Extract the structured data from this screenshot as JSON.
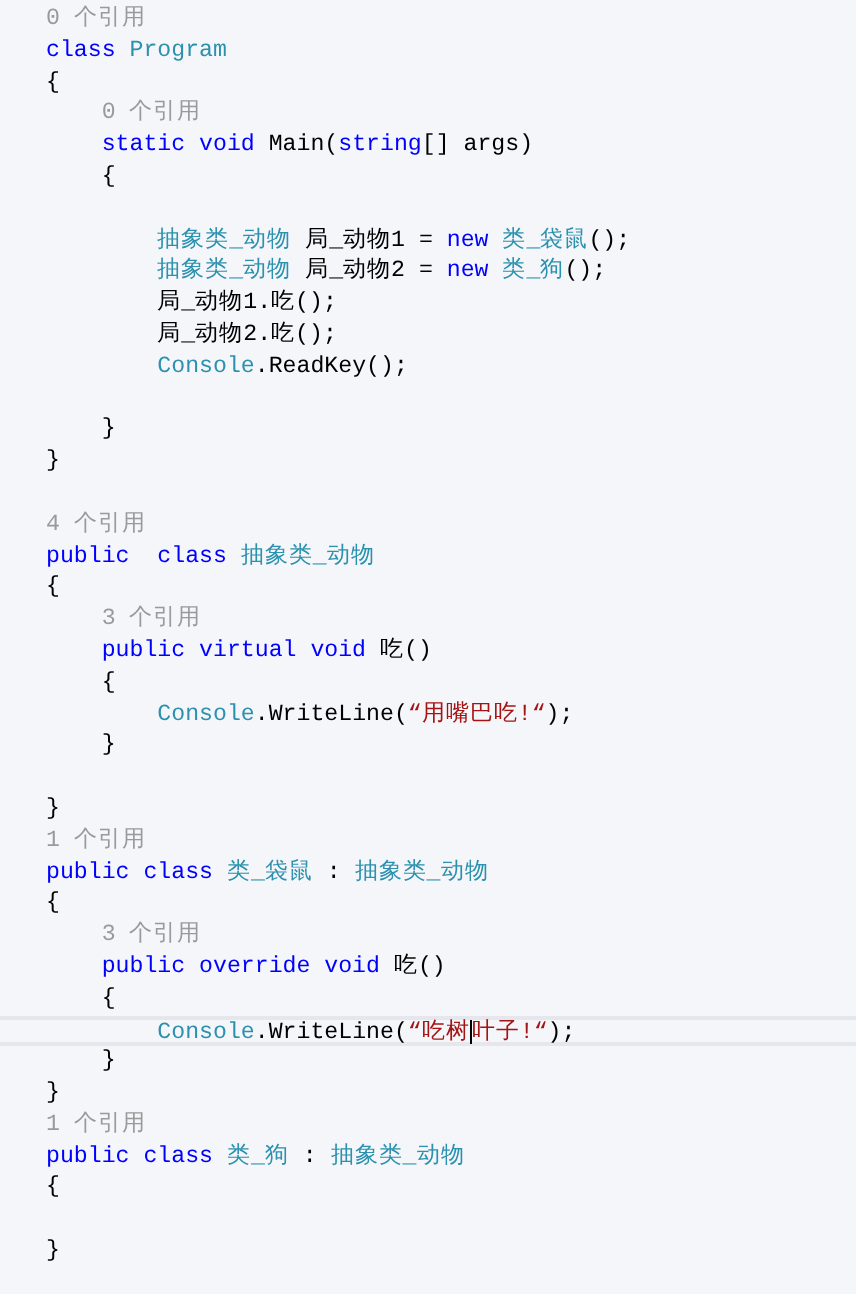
{
  "editor": {
    "lines": [
      {
        "tokens": [
          {
            "text": "0 个引用",
            "kind": "lens"
          }
        ]
      },
      {
        "tokens": [
          {
            "text": "class ",
            "kind": "keyword"
          },
          {
            "text": "Program",
            "kind": "type"
          }
        ]
      },
      {
        "tokens": [
          {
            "text": "{",
            "kind": "plain"
          }
        ]
      },
      {
        "tokens": [
          {
            "text": "    0 个引用",
            "kind": "lens"
          }
        ]
      },
      {
        "tokens": [
          {
            "text": "    static void ",
            "kind": "keyword"
          },
          {
            "text": "Main(",
            "kind": "plain"
          },
          {
            "text": "string",
            "kind": "keyword"
          },
          {
            "text": "[] args)",
            "kind": "plain"
          }
        ]
      },
      {
        "tokens": [
          {
            "text": "    {",
            "kind": "plain"
          }
        ]
      },
      {
        "space_before": true,
        "tokens": [
          {
            "text": "        抽象类_动物",
            "kind": "type"
          },
          {
            "text": " 局_动物1 = ",
            "kind": "plain"
          },
          {
            "text": "new ",
            "kind": "keyword"
          },
          {
            "text": "类_袋鼠",
            "kind": "type"
          },
          {
            "text": "();",
            "kind": "plain"
          }
        ]
      },
      {
        "tokens": [
          {
            "text": "        抽象类_动物",
            "kind": "type"
          },
          {
            "text": " 局_动物2 = ",
            "kind": "plain"
          },
          {
            "text": "new ",
            "kind": "keyword"
          },
          {
            "text": "类_狗",
            "kind": "type"
          },
          {
            "text": "();",
            "kind": "plain"
          }
        ]
      },
      {
        "tokens": [
          {
            "text": "        局_动物1.吃();",
            "kind": "plain"
          }
        ]
      },
      {
        "tokens": [
          {
            "text": "        局_动物2.吃();",
            "kind": "plain"
          }
        ]
      },
      {
        "tokens": [
          {
            "text": "        Console",
            "kind": "type"
          },
          {
            "text": ".ReadKey();",
            "kind": "plain"
          }
        ]
      },
      {
        "space_before": true,
        "tokens": [
          {
            "text": "    }",
            "kind": "plain"
          }
        ]
      },
      {
        "tokens": [
          {
            "text": "}",
            "kind": "plain"
          }
        ]
      },
      {
        "space_before": true,
        "tokens": [
          {
            "text": "4 个引用",
            "kind": "lens"
          }
        ]
      },
      {
        "tokens": [
          {
            "text": "public  class ",
            "kind": "keyword"
          },
          {
            "text": "抽象类_动物",
            "kind": "type"
          }
        ]
      },
      {
        "tokens": [
          {
            "text": "{",
            "kind": "plain"
          }
        ]
      },
      {
        "tokens": [
          {
            "text": "    3 个引用",
            "kind": "lens"
          }
        ]
      },
      {
        "tokens": [
          {
            "text": "    public virtual void ",
            "kind": "keyword"
          },
          {
            "text": "吃()",
            "kind": "plain"
          }
        ]
      },
      {
        "tokens": [
          {
            "text": "    {",
            "kind": "plain"
          }
        ]
      },
      {
        "tokens": [
          {
            "text": "        Console",
            "kind": "type"
          },
          {
            "text": ".WriteLine(",
            "kind": "plain"
          },
          {
            "text": "“用嘴巴吃!“",
            "kind": "string"
          },
          {
            "text": ");",
            "kind": "plain"
          }
        ]
      },
      {
        "tokens": [
          {
            "text": "    }",
            "kind": "plain"
          }
        ]
      },
      {
        "space_before": true,
        "tokens": [
          {
            "text": "}",
            "kind": "plain"
          }
        ]
      },
      {
        "tokens": [
          {
            "text": "1 个引用",
            "kind": "lens"
          }
        ]
      },
      {
        "tokens": [
          {
            "text": "public class ",
            "kind": "keyword"
          },
          {
            "text": "类_袋鼠",
            "kind": "type"
          },
          {
            "text": " : ",
            "kind": "plain"
          },
          {
            "text": "抽象类_动物",
            "kind": "type"
          }
        ]
      },
      {
        "tokens": [
          {
            "text": "{",
            "kind": "plain"
          }
        ]
      },
      {
        "tokens": [
          {
            "text": "    3 个引用",
            "kind": "lens"
          }
        ]
      },
      {
        "tokens": [
          {
            "text": "    public override void ",
            "kind": "keyword"
          },
          {
            "text": "吃()",
            "kind": "plain"
          }
        ]
      },
      {
        "tokens": [
          {
            "text": "    {",
            "kind": "plain"
          }
        ]
      },
      {
        "current": true,
        "tokens": [
          {
            "text": "        Console",
            "kind": "type"
          },
          {
            "text": ".WriteLine(",
            "kind": "plain"
          },
          {
            "text": "“吃树",
            "kind": "string",
            "caret_after": true
          },
          {
            "text": "叶子!“",
            "kind": "string"
          },
          {
            "text": ");",
            "kind": "plain"
          }
        ]
      },
      {
        "tokens": [
          {
            "text": "    }",
            "kind": "plain"
          }
        ]
      },
      {
        "tokens": [
          {
            "text": "}",
            "kind": "plain"
          }
        ]
      },
      {
        "tokens": [
          {
            "text": "1 个引用",
            "kind": "lens"
          }
        ]
      },
      {
        "tokens": [
          {
            "text": "public class ",
            "kind": "keyword"
          },
          {
            "text": "类_狗",
            "kind": "type"
          },
          {
            "text": " : ",
            "kind": "plain"
          },
          {
            "text": "抽象类_动物",
            "kind": "type"
          }
        ]
      },
      {
        "tokens": [
          {
            "text": "{",
            "kind": "plain"
          }
        ]
      },
      {
        "space_before": true,
        "tokens": [
          {
            "text": "}",
            "kind": "plain"
          }
        ]
      }
    ]
  }
}
